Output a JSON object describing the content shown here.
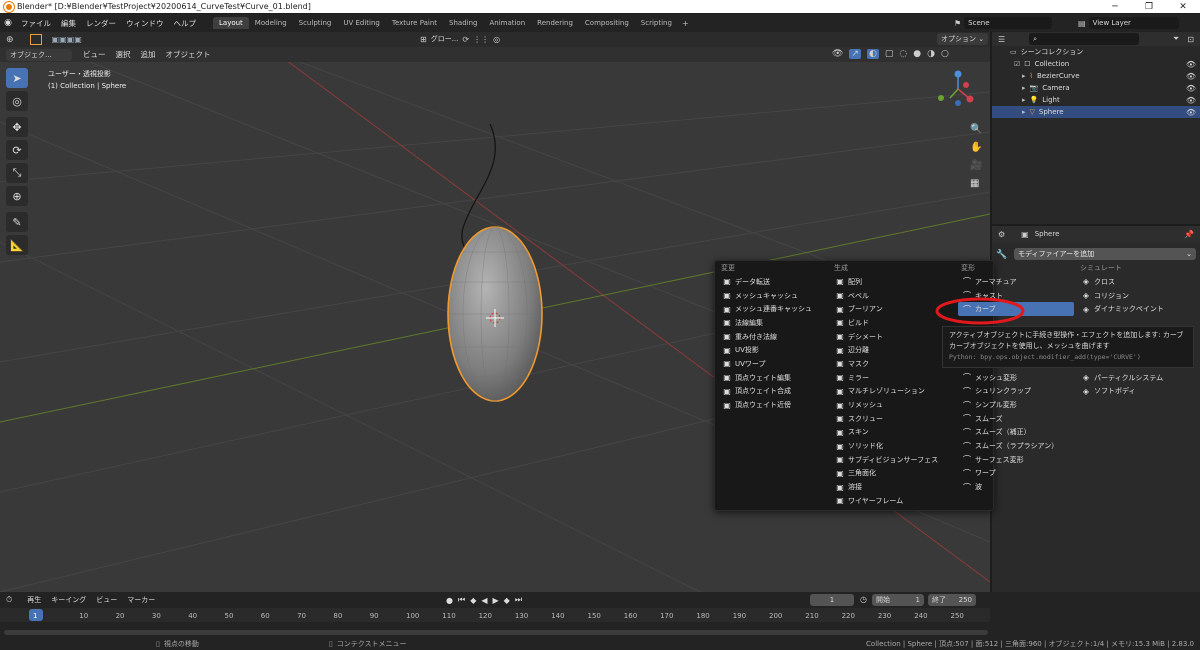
{
  "window": {
    "title": "Blender* [D:¥Blender¥TestProject¥20200614_CurveTest¥Curve_01.blend]"
  },
  "menu": [
    "ファイル",
    "編集",
    "レンダー",
    "ウィンドウ",
    "ヘルプ"
  ],
  "workspaces": [
    "Layout",
    "Modeling",
    "Sculpting",
    "UV Editing",
    "Texture Paint",
    "Shading",
    "Animation",
    "Rendering",
    "Compositing",
    "Scripting"
  ],
  "scene": {
    "name": "Scene",
    "view_layer": "View Layer"
  },
  "viewport_header": {
    "mode": "オブジェク...",
    "menus": [
      "ビュー",
      "選択",
      "追加",
      "オブジェクト"
    ],
    "transform": "グロー...",
    "options": "オプション"
  },
  "viewport": {
    "view_name": "ユーザー・透視投影",
    "collection_info": "(1) Collection | Sphere"
  },
  "outliner": {
    "root": "シーンコレクション",
    "items": [
      {
        "name": "Collection",
        "level": 1
      },
      {
        "name": "BezierCurve",
        "level": 2
      },
      {
        "name": "Camera",
        "level": 2
      },
      {
        "name": "Light",
        "level": 2
      },
      {
        "name": "Sphere",
        "level": 2,
        "selected": true
      }
    ]
  },
  "properties": {
    "object": "Sphere",
    "add_modifier": "モディファイアーを追加"
  },
  "modifier_menu": {
    "columns": [
      {
        "heading": "変更",
        "items": [
          "データ転送",
          "メッシュキャッシュ",
          "メッシュ連番キャッシュ",
          "法線編集",
          "重み付き法線",
          "UV投影",
          "UVワープ",
          "頂点ウェイト編集",
          "頂点ウェイト合成",
          "頂点ウェイト近傍"
        ]
      },
      {
        "heading": "生成",
        "items": [
          "配列",
          "ベベル",
          "ブーリアン",
          "ビルド",
          "デシメート",
          "辺分離",
          "マスク",
          "ミラー",
          "マルチレゾリューション",
          "リメッシュ",
          "スクリュー",
          "スキン",
          "ソリッド化",
          "サブディビジョンサーフェス",
          "三角面化",
          "溶接",
          "ワイヤーフレーム"
        ]
      },
      {
        "heading": "変形",
        "items": [
          "アーマチュア",
          "キャスト",
          "カーブ",
          "",
          "",
          "",
          "",
          "メッシュ変形",
          "シュリンクラップ",
          "シンプル変形",
          "スムーズ",
          "スムーズ（補正）",
          "スムーズ（ラプラシアン）",
          "サーフェス変形",
          "ワープ",
          "波"
        ]
      },
      {
        "heading": "シミュレート",
        "items": [
          "クロス",
          "コリジョン",
          "ダイナミックペイント",
          "",
          "",
          "",
          "",
          "パーティクルシステム",
          "ソフトボディ"
        ]
      }
    ],
    "highlighted": "カーブ"
  },
  "tooltip": {
    "line1": "アクティブオブジェクトに手続き型操作・エフェクトを追加します: カーブ",
    "line2": "カーブオブジェクトを使用し、メッシュを曲げます",
    "python": "Python: bpy.ops.object.modifier_add(type='CURVE')"
  },
  "timeline": {
    "menus": [
      "再生",
      "キーイング",
      "ビュー",
      "マーカー"
    ],
    "current_frame": "1",
    "start_label": "開始",
    "start": "1",
    "end_label": "終了",
    "end": "250",
    "ticks": [
      "1",
      "10",
      "20",
      "30",
      "40",
      "50",
      "60",
      "70",
      "80",
      "90",
      "100",
      "110",
      "120",
      "130",
      "140",
      "150",
      "160",
      "170",
      "180",
      "190",
      "200",
      "210",
      "220",
      "230",
      "240",
      "250"
    ]
  },
  "statusbar": {
    "left": "視点の移動",
    "middle": "コンテクストメニュー",
    "right": "Collection | Sphere | 頂点:507 | 面:512 | 三角面:960 | オブジェクト:1/4 | メモリ:15.3 MiB | 2.83.0"
  }
}
